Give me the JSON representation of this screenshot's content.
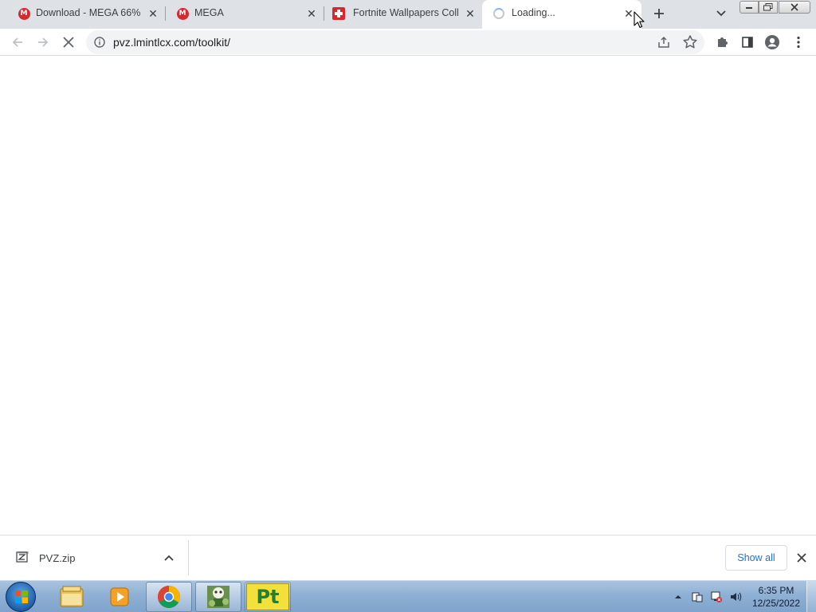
{
  "browser": {
    "tabs": [
      {
        "title": "Download - MEGA 66%",
        "favicon": "mega-icon",
        "active": false
      },
      {
        "title": "MEGA",
        "favicon": "mega-icon",
        "active": false
      },
      {
        "title": "Fortnite Wallpapers Colle",
        "favicon": "red-cross-icon",
        "active": false
      },
      {
        "title": "Loading...",
        "favicon": "loading-spinner-icon",
        "active": true
      }
    ],
    "mega_letter": "M",
    "address": "pvz.lmintlcx.com/toolkit/"
  },
  "download_shelf": {
    "file_name": "PVZ.zip",
    "show_all_label": "Show all"
  },
  "taskbar": {
    "apps": [
      "file-explorer-icon",
      "media-player-icon",
      "chrome-icon",
      "game-icon",
      "pt-app-icon"
    ],
    "pt_label": "Pt",
    "clock_time": "6:35 PM",
    "clock_date": "12/25/2022"
  },
  "colors": {
    "tabstrip_bg": "#dee1e6",
    "mega_red": "#d9272e",
    "link_blue": "#1a73e8",
    "taskbar_blue": "#8fb0d4"
  }
}
